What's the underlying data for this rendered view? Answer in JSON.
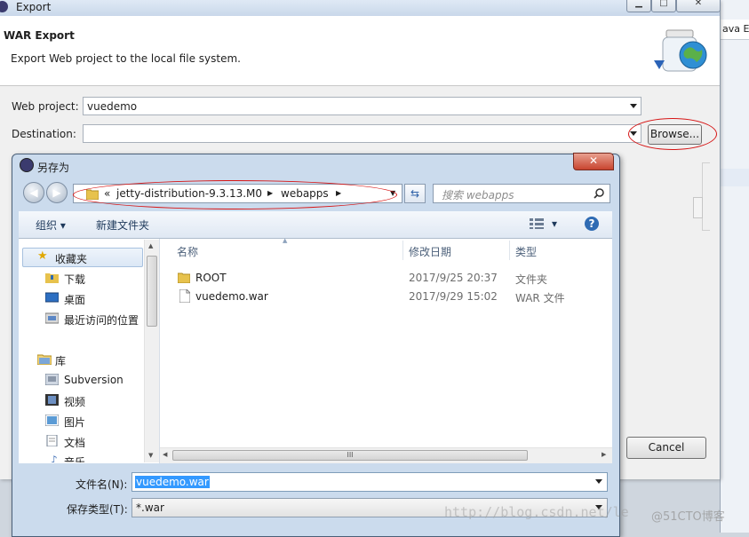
{
  "background_window": {
    "tab_label": "ava E"
  },
  "export_window": {
    "title": "Export",
    "page_title": "WAR Export",
    "description": "Export Web project to the local file system.",
    "web_project_label": "Web project:",
    "web_project_value": "vuedemo",
    "destination_label": "Destination:",
    "destination_value": "",
    "browse_label": "Browse...",
    "cancel_label": "Cancel"
  },
  "save_dialog": {
    "title": "另存为",
    "close_label": "✕",
    "breadcrumb": {
      "prefix": "«",
      "segments": [
        "jetty-distribution-9.3.13.M0",
        "webapps"
      ]
    },
    "search_placeholder": "搜索 webapps",
    "toolbar": {
      "organize": "组织 ▾",
      "new_folder": "新建文件夹",
      "help": "?"
    },
    "sidebar": {
      "favorites_label": "收藏夹",
      "favorites": [
        "下载",
        "桌面",
        "最近访问的位置"
      ],
      "library_label": "库",
      "library": [
        "Subversion",
        "视频",
        "图片",
        "文档",
        "音乐"
      ]
    },
    "columns": {
      "name": "名称",
      "modified": "修改日期",
      "type": "类型"
    },
    "files": [
      {
        "name": "ROOT",
        "modified": "2017/9/25 20:37",
        "type": "文件夹",
        "icon": "folder-icon"
      },
      {
        "name": "vuedemo.war",
        "modified": "2017/9/29 15:02",
        "type": "WAR 文件",
        "icon": "file-icon"
      }
    ],
    "scroll_thumb": "III",
    "filename_label": "文件名(N):",
    "filename_value": "vuedemo.war",
    "filetype_label": "保存类型(T):",
    "filetype_value": "*.war"
  },
  "watermark": "http://blog.csdn.net/le",
  "watermark_logo": "@51CTO博客",
  "colors": {
    "annotation": "#d61515",
    "selection": "#3399ff",
    "link": "#2f6bb3"
  }
}
